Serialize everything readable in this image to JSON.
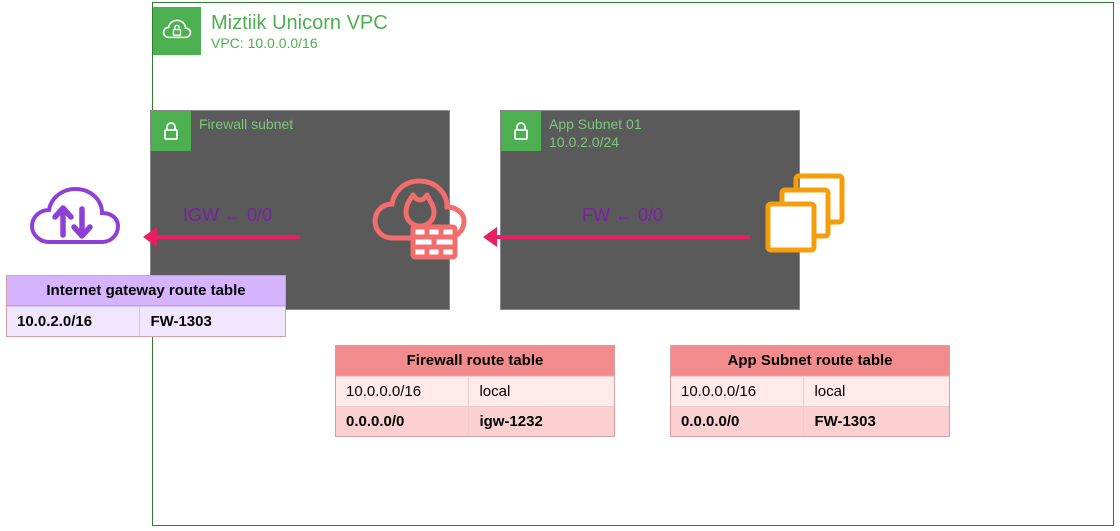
{
  "vpc": {
    "title": "Miztiik Unicorn VPC",
    "subtitle": "VPC: 10.0.0.0/16"
  },
  "subnets": {
    "firewall": {
      "label": "Firewall subnet",
      "cidr": ""
    },
    "app": {
      "label": "App Subnet 01",
      "cidr": "10.0.2.0/24"
    }
  },
  "arrows": {
    "fw_to_igw": "IGW ← 0/0",
    "app_to_fw": "FW ← 0/0"
  },
  "route_tables": {
    "igw": {
      "title": "Internet gateway route table",
      "rows": [
        {
          "dest": "10.0.2.0/16",
          "target": "FW-1303"
        }
      ]
    },
    "firewall": {
      "title": "Firewall route table",
      "rows": [
        {
          "dest": "10.0.0.0/16",
          "target": "local"
        },
        {
          "dest": "0.0.0.0/0",
          "target": "igw-1232"
        }
      ]
    },
    "app": {
      "title": "App Subnet route table",
      "rows": [
        {
          "dest": "10.0.0.0/16",
          "target": "local"
        },
        {
          "dest": "0.0.0.0/0",
          "target": "FW-1303"
        }
      ]
    }
  },
  "icons": {
    "igw": "internet-gateway-icon",
    "firewall": "network-firewall-icon",
    "app": "ec2-instances-icon",
    "vpc_lock": "cloud-lock-icon",
    "subnet_lock": "lock-icon"
  }
}
